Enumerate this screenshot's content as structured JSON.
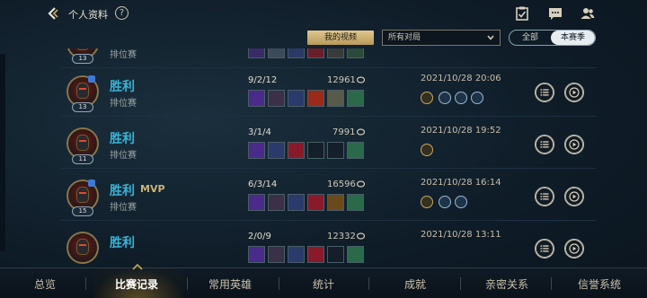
{
  "header": {
    "title": "个人资料",
    "help": "?"
  },
  "filters": {
    "my_video": "我的视频",
    "match_type": "所有对局",
    "season_all": "全部",
    "season_current": "本赛季"
  },
  "partial_row": {
    "mode": "排位赛",
    "level": "13"
  },
  "matches": [
    {
      "result": "胜利",
      "mvp": "",
      "mode": "排位赛",
      "level": "13",
      "kda": "9/2/12",
      "gold": "12961",
      "datetime": "2021/10/28 20:06",
      "medals": [
        "gold",
        "blue",
        "blue",
        "blue"
      ]
    },
    {
      "result": "胜利",
      "mvp": "",
      "mode": "排位赛",
      "level": "11",
      "kda": "3/1/4",
      "gold": "7991",
      "datetime": "2021/10/28 19:52",
      "medals": [
        "gold"
      ]
    },
    {
      "result": "胜利",
      "mvp": "MVP",
      "mode": "排位赛",
      "level": "15",
      "kda": "6/3/14",
      "gold": "16596",
      "datetime": "2021/10/28 16:14",
      "medals": [
        "gold",
        "blue",
        "blue"
      ]
    },
    {
      "result": "胜利",
      "mvp": "",
      "mode": "",
      "level": "",
      "kda": "2/0/9",
      "gold": "12332",
      "datetime": "2021/10/28 13:11",
      "medals": []
    }
  ],
  "nav": {
    "items": [
      "总览",
      "比赛记录",
      "常用英雄",
      "统计",
      "成就",
      "亲密关系",
      "信誉系统"
    ],
    "active": "比赛记录"
  },
  "colors": {
    "win": "#36b4d8",
    "gold_accent": "#c9a75a",
    "background": "#0c1722"
  },
  "icons": {
    "back": "chevron-left-icon",
    "help": "question-icon",
    "tasks": "clipboard-check-icon",
    "chat": "chat-bubble-icon",
    "friends": "friends-icon",
    "gold": "gold-coin-icon",
    "detail": "list-icon",
    "replay": "play-icon"
  }
}
